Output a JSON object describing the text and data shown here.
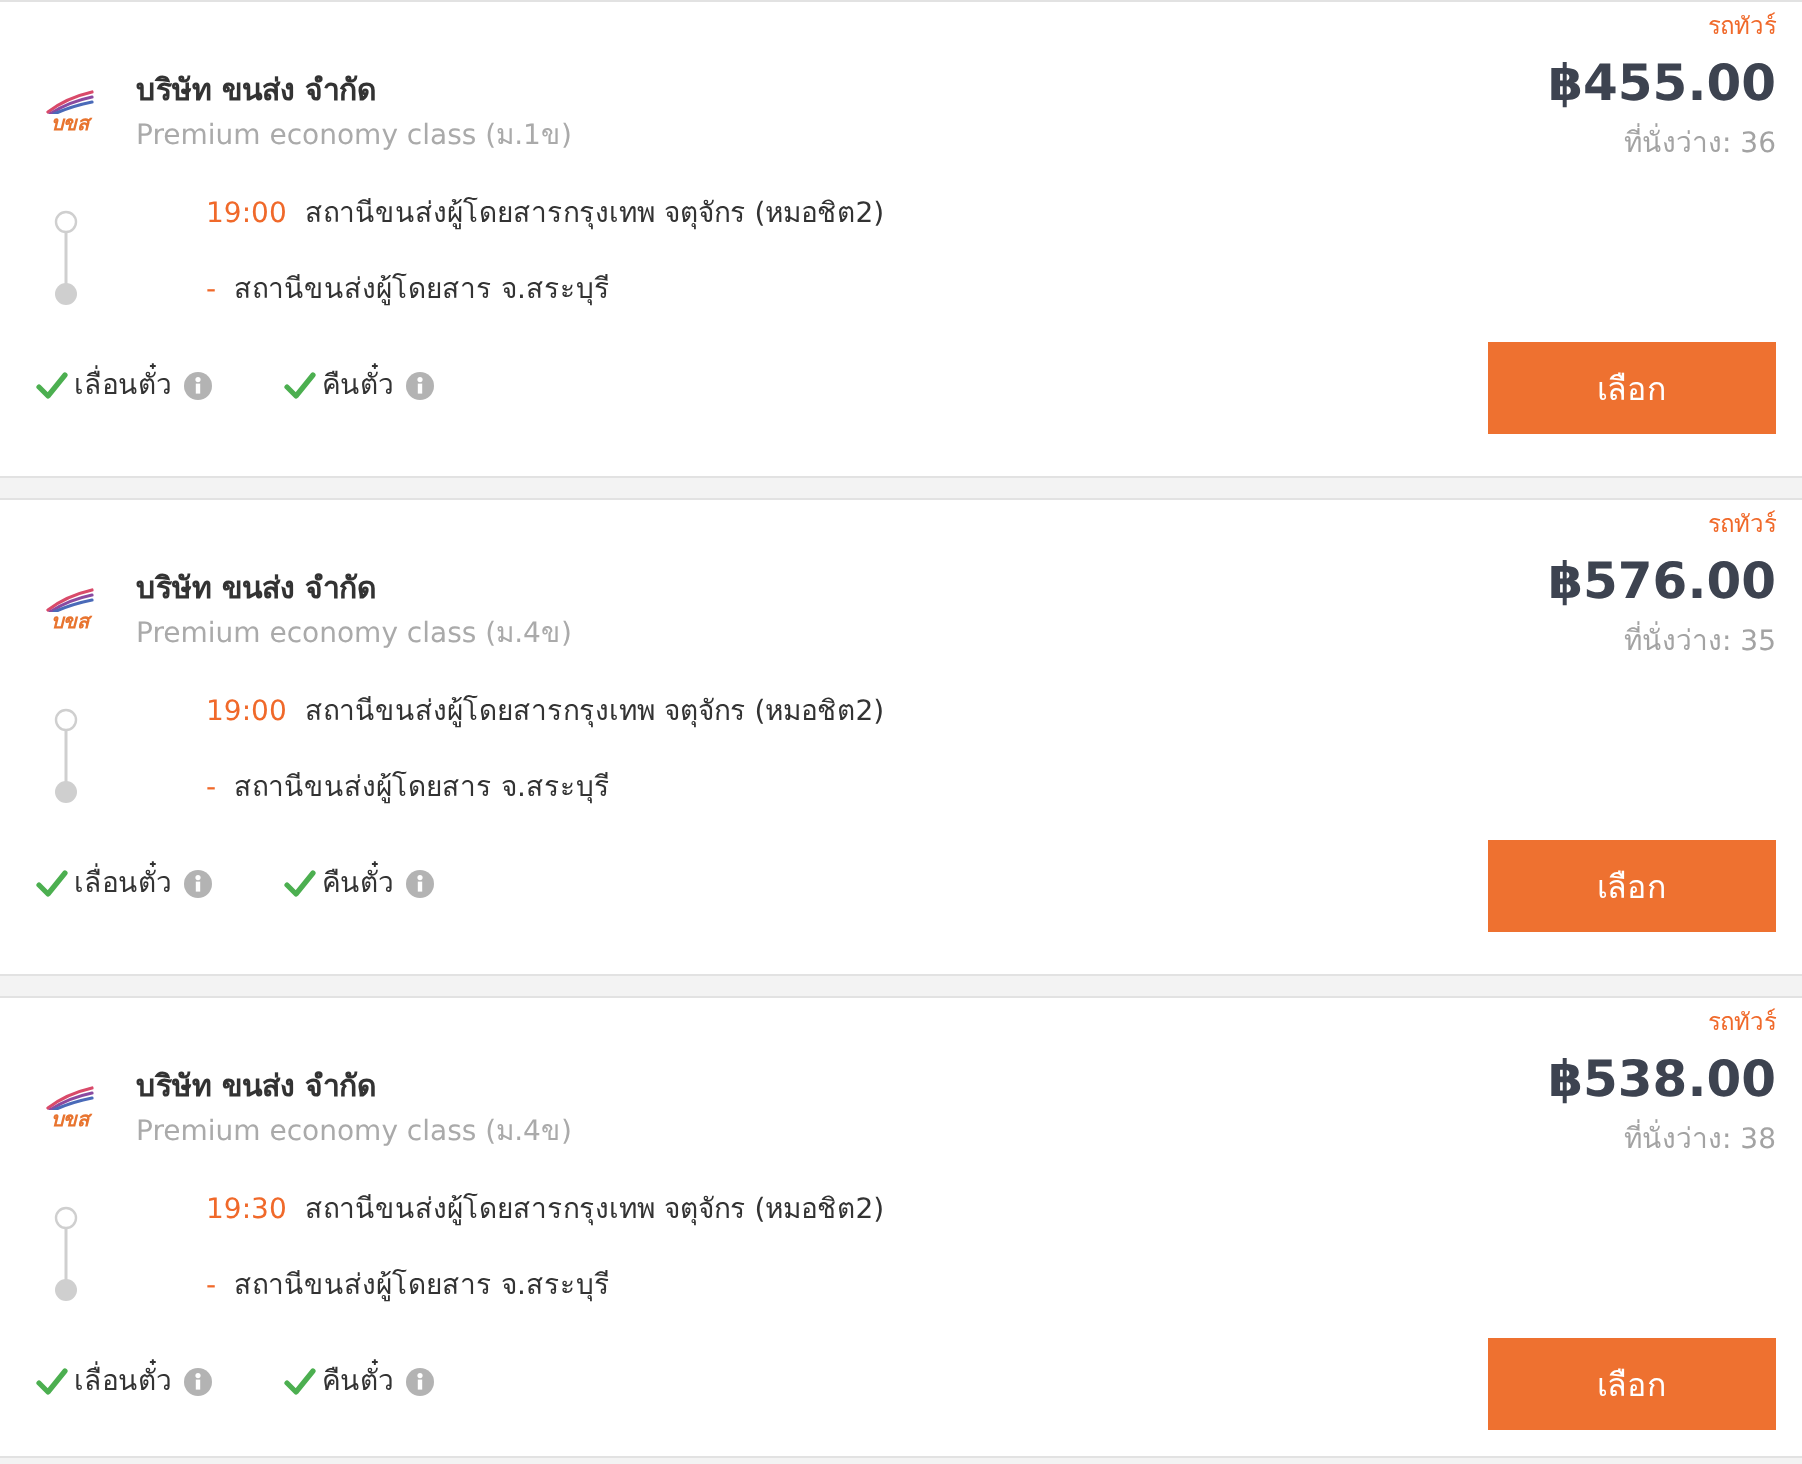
{
  "trips": [
    {
      "vehicle_type": "รถทัวร์",
      "logo_text": "บขส",
      "company": "บริษัท ขนส่ง จำกัด",
      "service_class": "Premium economy class (ม.1ข)",
      "price": "฿455.00",
      "seats_left": "ที่นั่งว่าง: 36",
      "stops": [
        {
          "time": "19:00",
          "station": "สถานีขนส่งผู้โดยสารกรุงเทพ จตุจักร (หมอชิต2)"
        },
        {
          "time": "-",
          "station": "สถานีขนส่งผู้โดยสาร จ.สระบุรี"
        }
      ],
      "features": [
        {
          "label": "เลื่อนตั๋ว",
          "checked": true
        },
        {
          "label": "คืนตั๋ว",
          "checked": true
        }
      ],
      "button": "เลือก"
    },
    {
      "vehicle_type": "รถทัวร์",
      "logo_text": "บขส",
      "company": "บริษัท ขนส่ง จำกัด",
      "service_class": "Premium economy class (ม.4ข)",
      "price": "฿576.00",
      "seats_left": "ที่นั่งว่าง: 35",
      "stops": [
        {
          "time": "19:00",
          "station": "สถานีขนส่งผู้โดยสารกรุงเทพ จตุจักร (หมอชิต2)"
        },
        {
          "time": "-",
          "station": "สถานีขนส่งผู้โดยสาร จ.สระบุรี"
        }
      ],
      "features": [
        {
          "label": "เลื่อนตั๋ว",
          "checked": true
        },
        {
          "label": "คืนตั๋ว",
          "checked": true
        }
      ],
      "button": "เลือก"
    },
    {
      "vehicle_type": "รถทัวร์",
      "logo_text": "บขส",
      "company": "บริษัท ขนส่ง จำกัด",
      "service_class": "Premium economy class (ม.4ข)",
      "price": "฿538.00",
      "seats_left": "ที่นั่งว่าง: 38",
      "stops": [
        {
          "time": "19:30",
          "station": "สถานีขนส่งผู้โดยสารกรุงเทพ จตุจักร (หมอชิต2)"
        },
        {
          "time": "-",
          "station": "สถานีขนส่งผู้โดยสาร จ.สระบุรี"
        }
      ],
      "features": [
        {
          "label": "เลื่อนตั๋ว",
          "checked": true
        },
        {
          "label": "คืนตั๋ว",
          "checked": true
        }
      ],
      "button": "เลือก"
    }
  ]
}
